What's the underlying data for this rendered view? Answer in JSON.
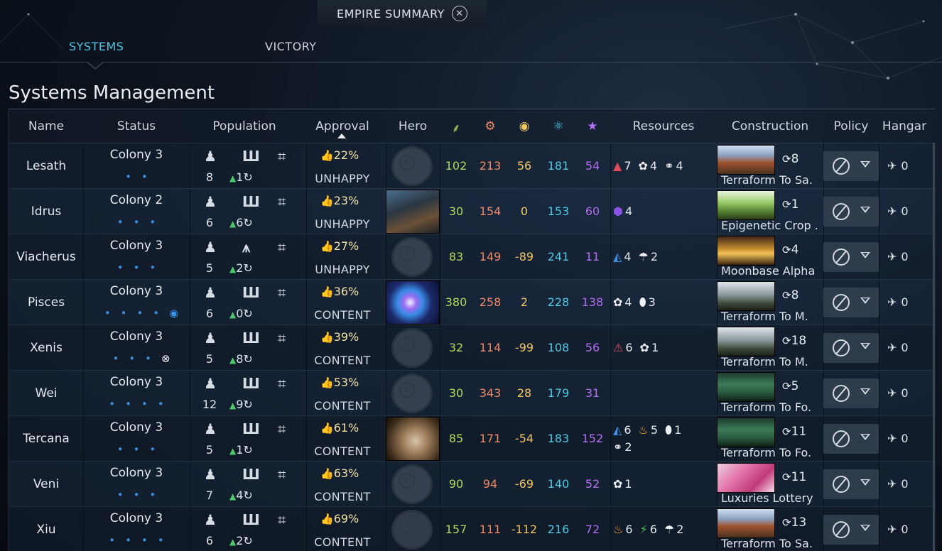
{
  "window": {
    "title": "EMPIRE SUMMARY",
    "close_icon": "✕"
  },
  "tabs": [
    {
      "label": "SYSTEMS",
      "active": true
    },
    {
      "label": "VICTORY",
      "active": false
    }
  ],
  "page_title": "Systems Management",
  "columns": {
    "name": "Name",
    "status": "Status",
    "population": "Population",
    "approval": "Approval",
    "hero": "Hero",
    "resources": "Resources",
    "construction": "Construction",
    "policy": "Policy",
    "hangar": "Hangar"
  },
  "stat_icons": {
    "food": "food-leaf-icon",
    "industry": "industry-gear-icon",
    "dust": "dust-coin-icon",
    "science": "science-atom-icon",
    "influence": "influence-star-icon"
  },
  "colors": {
    "accent": "#4fc5e6",
    "food": "#b6d75b",
    "industry": "#ef8a66",
    "dust": "#f1c764",
    "science": "#4fc9e6",
    "influence": "#b26ef0",
    "approval_thumb": "#e060c8",
    "growth": "#4fc96b"
  },
  "rows": [
    {
      "name": "Lesath",
      "status": "Colony 3",
      "pop": "8",
      "growth": "1",
      "approval": "22%",
      "state": "UNHAPPY",
      "food": "102",
      "industry": "213",
      "dust": "56",
      "science": "181",
      "influence": "54",
      "res": [
        [
          "▲",
          "#e04a5a",
          "7"
        ],
        [
          "✿",
          "#eef1f4",
          "4"
        ],
        [
          "⚭",
          "#eef1f4",
          "4"
        ]
      ],
      "res2": [],
      "turns": "8",
      "construction": "Terraform To Sa.",
      "hangar": "0"
    },
    {
      "name": "Idrus",
      "status": "Colony 2",
      "pop": "6",
      "growth": "6",
      "approval": "23%",
      "state": "UNHAPPY",
      "food": "30",
      "industry": "154",
      "dust": "0",
      "science": "153",
      "influence": "60",
      "res": [
        [
          "⬢",
          "#8a52e6",
          "4"
        ]
      ],
      "res2": [],
      "turns": "1",
      "construction": "Epigenetic Crop .",
      "hangar": "0"
    },
    {
      "name": "Viacherus",
      "status": "Colony 3",
      "pop": "5",
      "growth": "2",
      "approval": "27%",
      "state": "UNHAPPY",
      "food": "83",
      "industry": "149",
      "dust": "-89",
      "science": "241",
      "influence": "11",
      "res": [
        [
          "◭",
          "#3f8ee8",
          "4"
        ],
        [
          "☂",
          "#eef1f4",
          "2"
        ]
      ],
      "res2": [],
      "turns": "4",
      "construction": "Moonbase Alpha",
      "hangar": "0"
    },
    {
      "name": "Pisces",
      "status": "Colony 3",
      "pop": "6",
      "growth": "0",
      "approval": "36%",
      "state": "CONTENT",
      "food": "380",
      "industry": "258",
      "dust": "2",
      "science": "228",
      "influence": "138",
      "res": [
        [
          "✿",
          "#eef1f4",
          "4"
        ],
        [
          "⬮",
          "#eef1f4",
          "3"
        ]
      ],
      "res2": [],
      "turns": "8",
      "construction": "Terraform To M.",
      "hangar": "0"
    },
    {
      "name": "Xenis",
      "status": "Colony 3",
      "pop": "5",
      "growth": "8",
      "approval": "39%",
      "state": "CONTENT",
      "food": "32",
      "industry": "114",
      "dust": "-99",
      "science": "108",
      "influence": "56",
      "res": [
        [
          "⚠",
          "#e04a5a",
          "6"
        ],
        [
          "✿",
          "#eef1f4",
          "1"
        ]
      ],
      "res2": [],
      "turns": "18",
      "construction": "Terraform To M.",
      "hangar": "0"
    },
    {
      "name": "Wei",
      "status": "Colony 3",
      "pop": "12",
      "growth": "9",
      "approval": "53%",
      "state": "CONTENT",
      "food": "30",
      "industry": "343",
      "dust": "28",
      "science": "179",
      "influence": "31",
      "res": [],
      "res2": [],
      "turns": "5",
      "construction": "Terraform To Fo.",
      "hangar": "0"
    },
    {
      "name": "Tercana",
      "status": "Colony 3",
      "pop": "5",
      "growth": "1",
      "approval": "61%",
      "state": "CONTENT",
      "food": "85",
      "industry": "171",
      "dust": "-54",
      "science": "183",
      "influence": "152",
      "res": [
        [
          "◭",
          "#3f8ee8",
          "6"
        ],
        [
          "♨",
          "#f0a030",
          "5"
        ],
        [
          "⬮",
          "#eef1f4",
          "1"
        ]
      ],
      "res2": [
        [
          "⚭",
          "#eef1f4",
          "2"
        ]
      ],
      "turns": "11",
      "construction": "Terraform To Fo.",
      "hangar": "0"
    },
    {
      "name": "Veni",
      "status": "Colony 3",
      "pop": "7",
      "growth": "4",
      "approval": "63%",
      "state": "CONTENT",
      "food": "90",
      "industry": "94",
      "dust": "-69",
      "science": "140",
      "influence": "52",
      "res": [
        [
          "✿",
          "#eef1f4",
          "1"
        ]
      ],
      "res2": [],
      "turns": "11",
      "construction": "Luxuries Lottery",
      "hangar": "0"
    },
    {
      "name": "Xiu",
      "status": "Colony 3",
      "pop": "6",
      "growth": "2",
      "approval": "69%",
      "state": "CONTENT",
      "food": "157",
      "industry": "111",
      "dust": "-112",
      "science": "216",
      "influence": "72",
      "res": [
        [
          "♨",
          "#f0a030",
          "6"
        ],
        [
          "⚡",
          "#3ec25a",
          "6"
        ],
        [
          "☂",
          "#eef1f4",
          "2"
        ]
      ],
      "res2": [],
      "turns": "13",
      "construction": "Terraform To Sa.",
      "hangar": "0"
    }
  ]
}
